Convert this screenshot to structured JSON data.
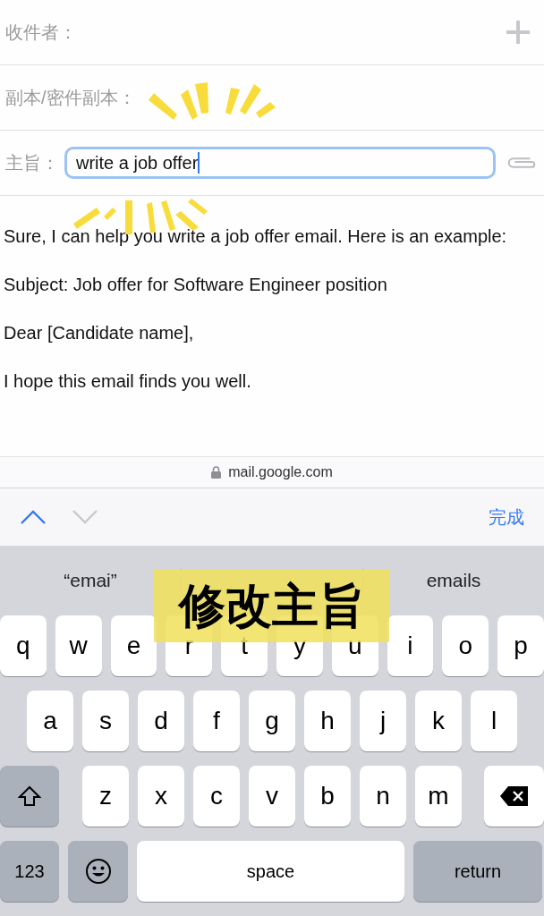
{
  "compose": {
    "to_label": "收件者：",
    "cc_label": "副本/密件副本：",
    "subject_label": "主旨：",
    "subject_value": "write a job offer"
  },
  "body": [
    "Sure, I can help you write a job offer email. Here is an example:",
    "Subject: Job offer for Software Engineer position",
    "Dear [Candidate name],",
    "I hope this email finds you well."
  ],
  "url_bar": {
    "url": "mail.google.com"
  },
  "toolbar": {
    "nav": [
      {
        "kind": "up",
        "disabled": false
      },
      {
        "kind": "down",
        "disabled": true
      }
    ],
    "done": "完成"
  },
  "suggestions": [
    "“emai”",
    "emails"
  ],
  "keyboard": {
    "rows": [
      [
        {
          "kind": "letter",
          "label": "q"
        },
        {
          "kind": "letter",
          "label": "w"
        },
        {
          "kind": "letter",
          "label": "e"
        },
        {
          "kind": "letter",
          "label": "r"
        },
        {
          "kind": "letter",
          "label": "t"
        },
        {
          "kind": "letter",
          "label": "y"
        },
        {
          "kind": "letter",
          "label": "u"
        },
        {
          "kind": "letter",
          "label": "i"
        },
        {
          "kind": "letter",
          "label": "o"
        },
        {
          "kind": "letter",
          "label": "p"
        }
      ],
      [
        {
          "kind": "letter",
          "label": "a"
        },
        {
          "kind": "letter",
          "label": "s"
        },
        {
          "kind": "letter",
          "label": "d"
        },
        {
          "kind": "letter",
          "label": "f"
        },
        {
          "kind": "letter",
          "label": "g"
        },
        {
          "kind": "letter",
          "label": "h"
        },
        {
          "kind": "letter",
          "label": "j"
        },
        {
          "kind": "letter",
          "label": "k"
        },
        {
          "kind": "letter",
          "label": "l"
        }
      ],
      [
        {
          "kind": "shift"
        },
        {
          "kind": "letter",
          "label": "z"
        },
        {
          "kind": "letter",
          "label": "x"
        },
        {
          "kind": "letter",
          "label": "c"
        },
        {
          "kind": "letter",
          "label": "v"
        },
        {
          "kind": "letter",
          "label": "b"
        },
        {
          "kind": "letter",
          "label": "n"
        },
        {
          "kind": "letter",
          "label": "m"
        },
        {
          "kind": "delete"
        }
      ]
    ],
    "bottom_bar": {
      "numbers": "123",
      "space": "space",
      "return": "return"
    }
  },
  "caption": "修改主旨"
}
